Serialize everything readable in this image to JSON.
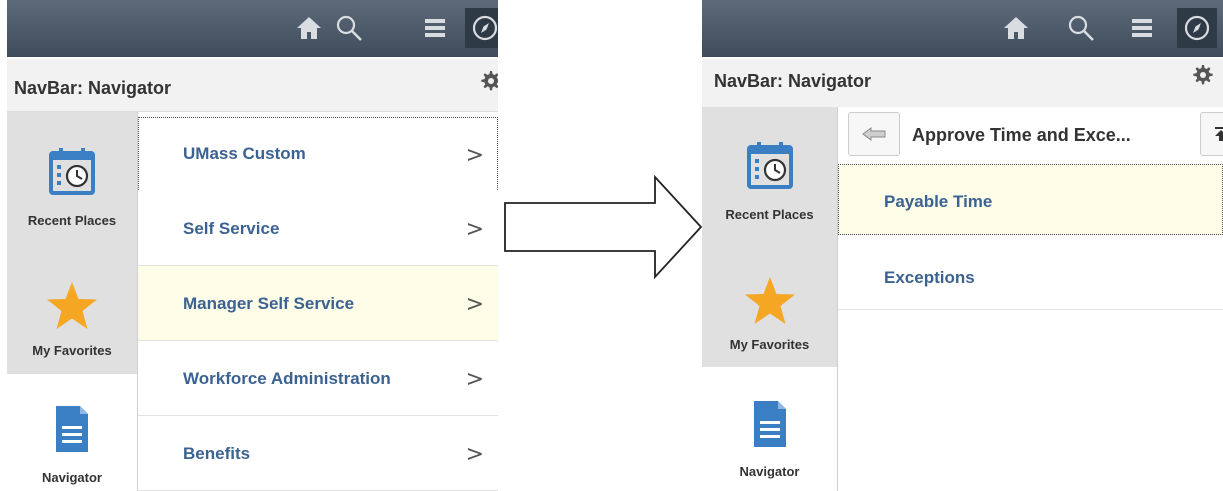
{
  "left_panel": {
    "title": "NavBar: Navigator",
    "sidebar": [
      {
        "label": "Recent Places",
        "icon": "calendar-clock-icon"
      },
      {
        "label": "My Favorites",
        "icon": "star-icon"
      },
      {
        "label": "Navigator",
        "icon": "document-icon"
      }
    ],
    "items": [
      {
        "label": "UMass Custom"
      },
      {
        "label": "Self Service"
      },
      {
        "label": "Manager Self Service"
      },
      {
        "label": "Workforce Administration"
      },
      {
        "label": "Benefits"
      }
    ],
    "chevron": ">"
  },
  "right_panel": {
    "title": "NavBar: Navigator",
    "sidebar": [
      {
        "label": "Recent Places",
        "icon": "calendar-clock-icon"
      },
      {
        "label": "My Favorites",
        "icon": "star-icon"
      },
      {
        "label": "Navigator",
        "icon": "document-icon"
      }
    ],
    "folder_title": "Approve Time and Exce...",
    "items": [
      {
        "label": "Payable Time"
      },
      {
        "label": "Exceptions"
      }
    ]
  },
  "header_icons": [
    "home-icon",
    "search-icon",
    "menu-icon",
    "compass-icon"
  ],
  "colors": {
    "header": "#4a5767",
    "link": "#3c6291",
    "highlight": "#fdfde8",
    "star": "#f5a623",
    "icon_blue": "#3a7fc4"
  }
}
